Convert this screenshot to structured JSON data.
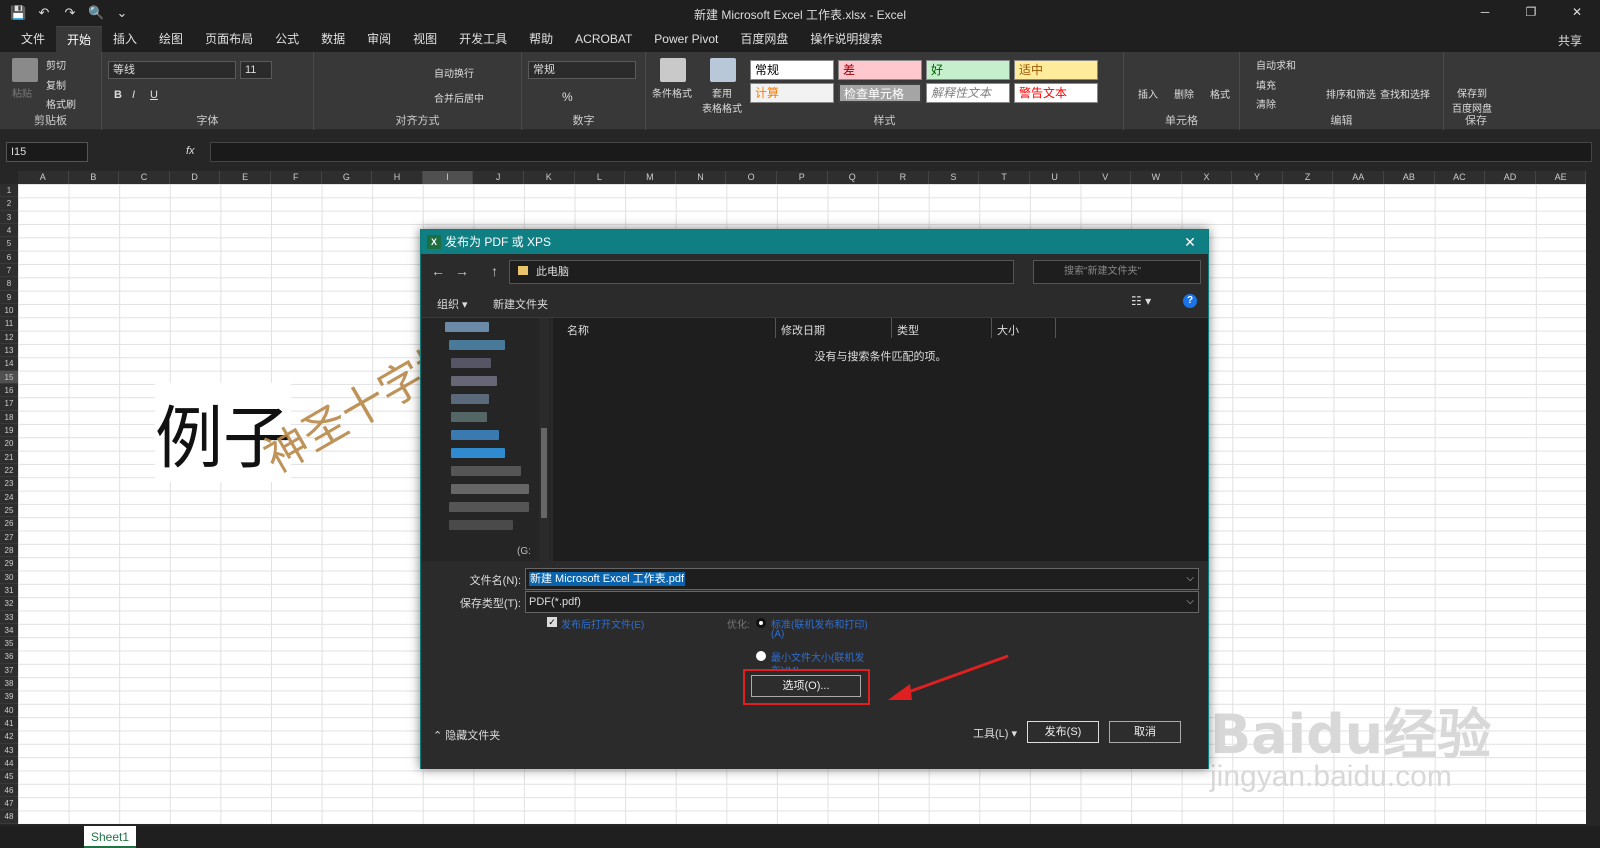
{
  "window": {
    "title": "新建 Microsoft Excel 工作表.xlsx  -  Excel",
    "minimize": "─",
    "restore": "❐",
    "close": "✕"
  },
  "qat": {
    "save": "💾",
    "undo": "↶",
    "redo": "↷",
    "preview": "🔍",
    "more": "⌄"
  },
  "tabs": [
    "文件",
    "开始",
    "插入",
    "绘图",
    "页面布局",
    "公式",
    "数据",
    "审阅",
    "视图",
    "开发工具",
    "帮助",
    "ACROBAT",
    "Power Pivot",
    "百度网盘",
    "操作说明搜索"
  ],
  "share": "共享",
  "ribbon": {
    "clipboard": {
      "label": "剪贴板",
      "paste": "粘贴",
      "cut": "剪切",
      "copy": "复制",
      "format_painter": "格式刷"
    },
    "font": {
      "label": "字体",
      "name": "等线",
      "size": "11",
      "bold": "B",
      "italic": "I",
      "underline": "U"
    },
    "alignment": {
      "label": "对齐方式",
      "wrap": "自动换行",
      "merge": "合并后居中"
    },
    "number": {
      "label": "数字",
      "format": "常规",
      "percent": "%"
    },
    "styles": {
      "label": "样式",
      "cond": "条件格式",
      "table": "套用\n表格格式",
      "cells": [
        "常规",
        "差",
        "好",
        "适中",
        "计算",
        "检查单元格",
        "解释性文本",
        "警告文本"
      ]
    },
    "cellsgrp": {
      "label": "单元格",
      "insert": "插入",
      "delete": "删除",
      "format": "格式"
    },
    "editing": {
      "label": "编辑",
      "autosum": "自动求和",
      "fill": "填充",
      "clear": "清除",
      "sort": "排序和筛选",
      "find": "查找和选择"
    },
    "save": {
      "label": "保存",
      "btn": "保存到\n百度网盘"
    }
  },
  "namebox": "I15",
  "fx": "fx",
  "columns": [
    "A",
    "B",
    "C",
    "D",
    "E",
    "F",
    "G",
    "H",
    "I",
    "J",
    "K",
    "L",
    "M",
    "N",
    "O",
    "P",
    "Q",
    "R",
    "S",
    "T",
    "U",
    "V",
    "W",
    "X",
    "Y",
    "Z",
    "AA",
    "AB",
    "AC",
    "AD",
    "AE"
  ],
  "rows": [
    "1",
    "2",
    "3",
    "4",
    "5",
    "6",
    "7",
    "8",
    "9",
    "10",
    "11",
    "12",
    "13",
    "14",
    "15",
    "16",
    "17",
    "18",
    "19",
    "20",
    "21",
    "22",
    "23",
    "24",
    "25",
    "26",
    "27",
    "28",
    "29",
    "30",
    "31",
    "32",
    "33",
    "34",
    "35",
    "36",
    "37",
    "38",
    "39",
    "40",
    "41",
    "42",
    "43",
    "44",
    "45",
    "46",
    "47",
    "48"
  ],
  "cell_text": "例子",
  "watermark": "神圣十字坡",
  "baidu": {
    "logo": "Baidu经验",
    "url": "jingyan.baidu.com"
  },
  "sheet_tab": "Sheet1",
  "dialog": {
    "title": "发布为 PDF 或 XPS",
    "xl_icon": "X",
    "address": "此电脑",
    "search_placeholder": "搜索\"新建文件夹\"",
    "organize": "组织 ▾",
    "new_folder": "新建文件夹",
    "drive_label": "(G:",
    "columns": [
      "名称",
      "修改日期",
      "类型",
      "大小"
    ],
    "empty": "没有与搜索条件匹配的项。",
    "filename_label": "文件名(N):",
    "filename": "新建 Microsoft Excel 工作表.pdf",
    "filetype_label": "保存类型(T):",
    "filetype": "PDF(*.pdf)",
    "open_after": "发布后打开文件(E)",
    "optimize": "优化:",
    "opt_standard": "标准(联机发布和打印)",
    "opt_standard_key": "(A)",
    "opt_min": "最小文件大小(联机发",
    "opt_min2": "布)(M)",
    "options_btn": "选项(O)...",
    "hide_folders": "隐藏文件夹",
    "tools": "工具(L)",
    "publish": "发布(S)",
    "cancel": "取消"
  }
}
